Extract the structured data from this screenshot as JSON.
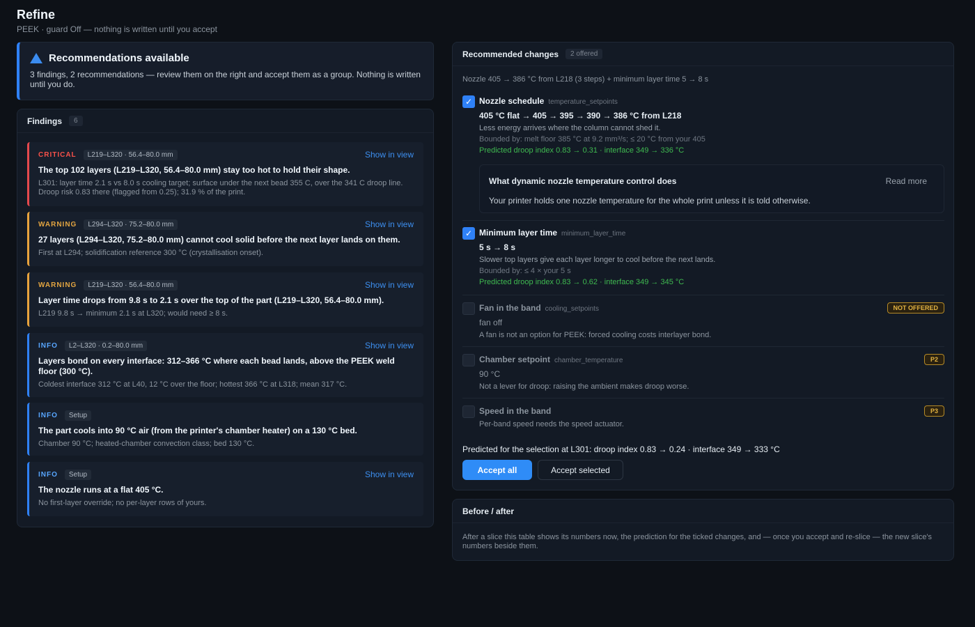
{
  "header": {
    "title": "Refine",
    "subtitle": "PEEK · guard Off — nothing is written until you accept"
  },
  "alert": {
    "icon": "warning-triangle-icon",
    "title": "Recommendations available",
    "body": "3 findings, 2 recommendations — review them on the right and accept them as a group. Nothing is written until you do."
  },
  "findings": {
    "title": "Findings",
    "count": "6",
    "items": [
      {
        "severity": "CRITICAL",
        "range": "L219–L320 · 56.4–80.0 mm",
        "action": "Show in view",
        "title": "The top 102 layers (L219–L320, 56.4–80.0 mm) stay too hot to hold their shape.",
        "desc": "L301: layer time 2.1 s vs 8.0 s cooling target; surface under the next bead 355 C, over the 341 C droop line. Droop risk 0.83 there (flagged from 0.25); 31.9 % of the print."
      },
      {
        "severity": "WARNING",
        "range": "L294–L320 · 75.2–80.0 mm",
        "action": "Show in view",
        "title": "27 layers (L294–L320, 75.2–80.0 mm) cannot cool solid before the next layer lands on them.",
        "desc": "First at L294; solidification reference 300 °C (crystallisation onset)."
      },
      {
        "severity": "WARNING",
        "range": "L219–L320 · 56.4–80.0 mm",
        "action": "Show in view",
        "title": "Layer time drops from 9.8 s to 2.1 s over the top of the part (L219–L320, 56.4–80.0 mm).",
        "desc": "L219 9.8 s → minimum 2.1 s at L320; would need ≥ 8 s."
      },
      {
        "severity": "INFO",
        "range": "L2–L320 · 0.2–80.0 mm",
        "action": "Show in view",
        "title": "Layers bond on every interface: 312–366 °C where each bead lands, above the PEEK weld floor (300 °C).",
        "desc": "Coldest interface 312 °C at L40, 12 °C over the floor; hottest 366 °C at L318; mean 317 °C."
      },
      {
        "severity": "INFO",
        "range": "Setup",
        "action": "",
        "title": "The part cools into 90 °C air (from the printer's chamber heater) on a 130 °C bed.",
        "desc": "Chamber 90 °C; heated-chamber convection class; bed 130 °C."
      },
      {
        "severity": "INFO",
        "range": "Setup",
        "action": "Show in view",
        "title": "The nozzle runs at a flat 405 °C.",
        "desc": "No first-layer override; no per-layer rows of yours."
      }
    ]
  },
  "recommended": {
    "title": "Recommended changes",
    "badge": "2 offered",
    "summary": "Nozzle 405 → 386 °C from L218 (3 steps) + minimum layer time 5 → 8 s",
    "items": [
      {
        "checked": true,
        "name": "Nozzle schedule",
        "key": "temperature_setpoints",
        "value": "405 °C flat  →  405 → 395 → 390 → 386 °C from L218",
        "line": "Less energy arrives where the column cannot shed it.",
        "bound": "Bounded by: melt floor 385 °C at 9.2 mm³/s; ≤ 20 °C from your 405",
        "predicted": "Predicted droop index 0.83 → 0.31 · interface 349 → 336 °C"
      },
      {
        "checked": true,
        "name": "Minimum layer time",
        "key": "minimum_layer_time",
        "value": "5 s  →  8 s",
        "line": "Slower top layers give each layer longer to cool before the next lands.",
        "bound": "Bounded by: ≤ 4 × your 5 s",
        "predicted": "Predicted droop index 0.83 → 0.62 · interface 349 → 345 °C"
      },
      {
        "checked": false,
        "name": "Fan in the band",
        "key": "cooling_setpoints",
        "value": "fan off",
        "line": "A fan is not an option for PEEK: forced cooling costs interlayer bond.",
        "pill": "NOT OFFERED"
      },
      {
        "checked": false,
        "name": "Chamber setpoint",
        "key": "chamber_temperature",
        "value": "90 °C",
        "line": "Not a lever for droop: raising the ambient makes droop worse.",
        "pill": "P2"
      },
      {
        "checked": false,
        "name": "Speed in the band",
        "key": "",
        "line": "Per-band speed needs the speed actuator.",
        "pill": "P3"
      }
    ],
    "explain": {
      "title": "What dynamic nozzle temperature control does",
      "more": "Read more",
      "text": "Your printer holds one nozzle temperature for the whole print unless it is told otherwise."
    },
    "prediction": "Predicted for the selection at L301: droop index 0.83 → 0.24 · interface 349 → 333 °C",
    "accept_all": "Accept all",
    "accept_selected": "Accept selected",
    "check_glyph": "✓"
  },
  "before_after": {
    "title": "Before / after",
    "body": "After a slice this table shows its numbers now, the prediction for the ticked changes, and — once you accept and re-slice — the new slice's numbers beside them."
  },
  "colors": {
    "accent": "#2f81f7",
    "critical": "#e5484d",
    "warning": "#e8a33d",
    "predicted": "#3fb950"
  }
}
